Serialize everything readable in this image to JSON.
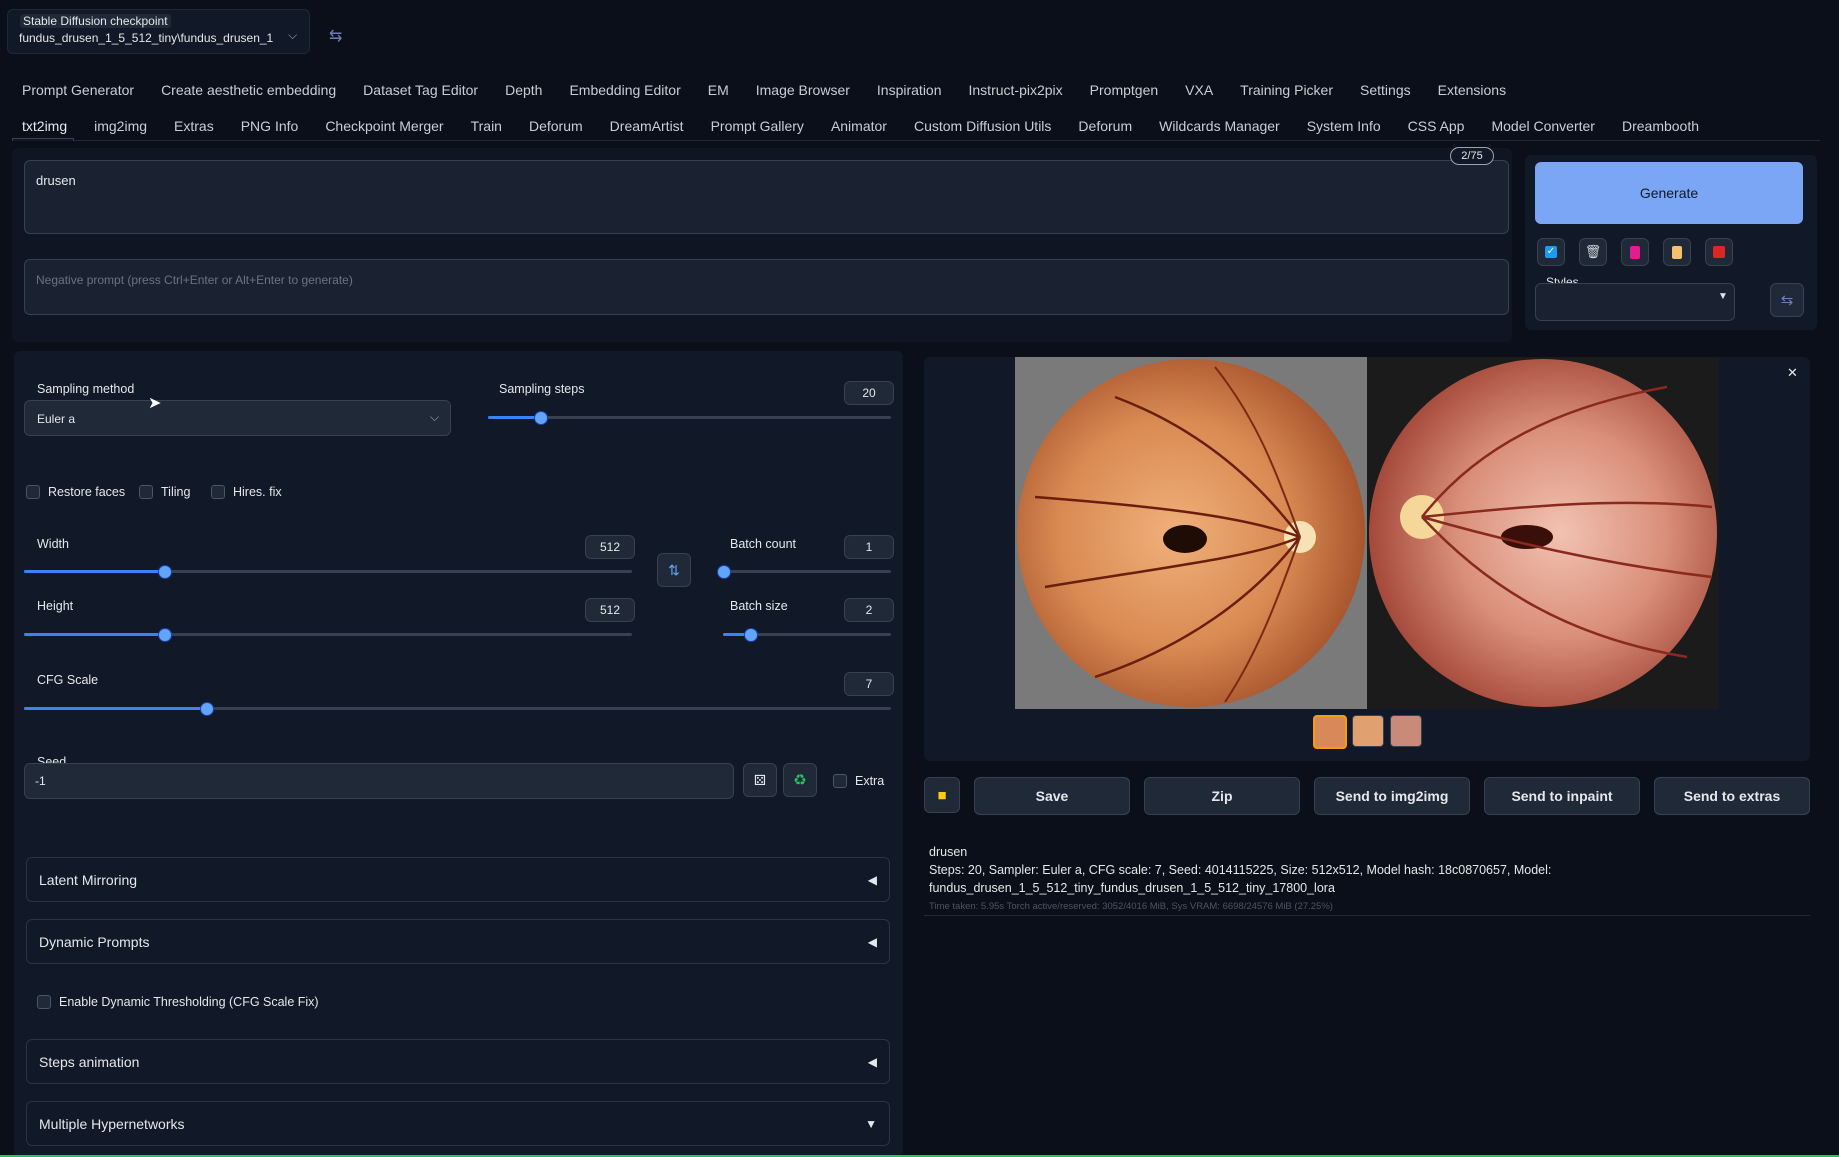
{
  "checkpoint": {
    "label": "Stable Diffusion checkpoint",
    "value": "fundus_drusen_1_5_512_tiny\\fundus_drusen_1"
  },
  "extension_tabs": [
    "Prompt Generator",
    "Create aesthetic embedding",
    "Dataset Tag Editor",
    "Depth",
    "Embedding Editor",
    "EM",
    "Image Browser",
    "Inspiration",
    "Instruct-pix2pix",
    "Promptgen",
    "VXA",
    "Training Picker",
    "Settings",
    "Extensions"
  ],
  "main_tabs": [
    "txt2img",
    "img2img",
    "Extras",
    "PNG Info",
    "Checkpoint Merger",
    "Train",
    "Deforum",
    "DreamArtist",
    "Prompt Gallery",
    "Animator",
    "Custom Diffusion Utils",
    "Deforum",
    "Wildcards Manager",
    "System Info",
    "CSS App",
    "Model Converter",
    "Dreambooth"
  ],
  "active_tab": "txt2img",
  "prompt": {
    "value": "drusen",
    "token_count": "2/75"
  },
  "negative_prompt": {
    "placeholder": "Negative prompt (press Ctrl+Enter or Alt+Enter to generate)"
  },
  "generate": {
    "label": "Generate"
  },
  "styles": {
    "label": "Styles"
  },
  "sampling": {
    "method_label": "Sampling method",
    "method_value": "Euler a",
    "steps_label": "Sampling steps",
    "steps_value": "20",
    "steps_fraction": 0.13
  },
  "checkboxes": {
    "restore_faces": "Restore faces",
    "tiling": "Tiling",
    "hires_fix": "Hires. fix"
  },
  "width": {
    "label": "Width",
    "value": "512",
    "fraction": 0.23
  },
  "height": {
    "label": "Height",
    "value": "512",
    "fraction": 0.23
  },
  "batch_count": {
    "label": "Batch count",
    "value": "1",
    "fraction": 0.0
  },
  "batch_size": {
    "label": "Batch size",
    "value": "2",
    "fraction": 0.16
  },
  "cfg": {
    "label": "CFG Scale",
    "value": "7",
    "fraction": 0.21
  },
  "seed": {
    "label": "Seed",
    "value": "-1",
    "extra_label": "Extra"
  },
  "accordions": {
    "latent_mirroring": "Latent Mirroring",
    "dynamic_prompts": "Dynamic Prompts",
    "dynamic_thresholding": "Enable Dynamic Thresholding (CFG Scale Fix)",
    "steps_animation": "Steps animation",
    "multiple_hypernetworks": "Multiple Hypernetworks"
  },
  "output_buttons": {
    "save": "Save",
    "zip": "Zip",
    "send_img2img": "Send to img2img",
    "send_inpaint": "Send to inpaint",
    "send_extras": "Send to extras"
  },
  "info": {
    "prompt": "drusen",
    "params_line1": "Steps: 20, Sampler: Euler a, CFG scale: 7, Seed: 4014115225, Size: 512x512, Model hash: 18c0870657, Model:",
    "params_line2": "fundus_drusen_1_5_512_tiny_fundus_drusen_1_5_512_tiny_17800_lora",
    "time": "Time taken: 5.95s  Torch active/reserved: 3052/4016 MiB, Sys VRAM: 6698/24576 MiB (27.25%)"
  },
  "colors": {
    "accent": "#3b82f6",
    "generate_bg": "#7aa6f5",
    "bg": "#0b0f19"
  }
}
